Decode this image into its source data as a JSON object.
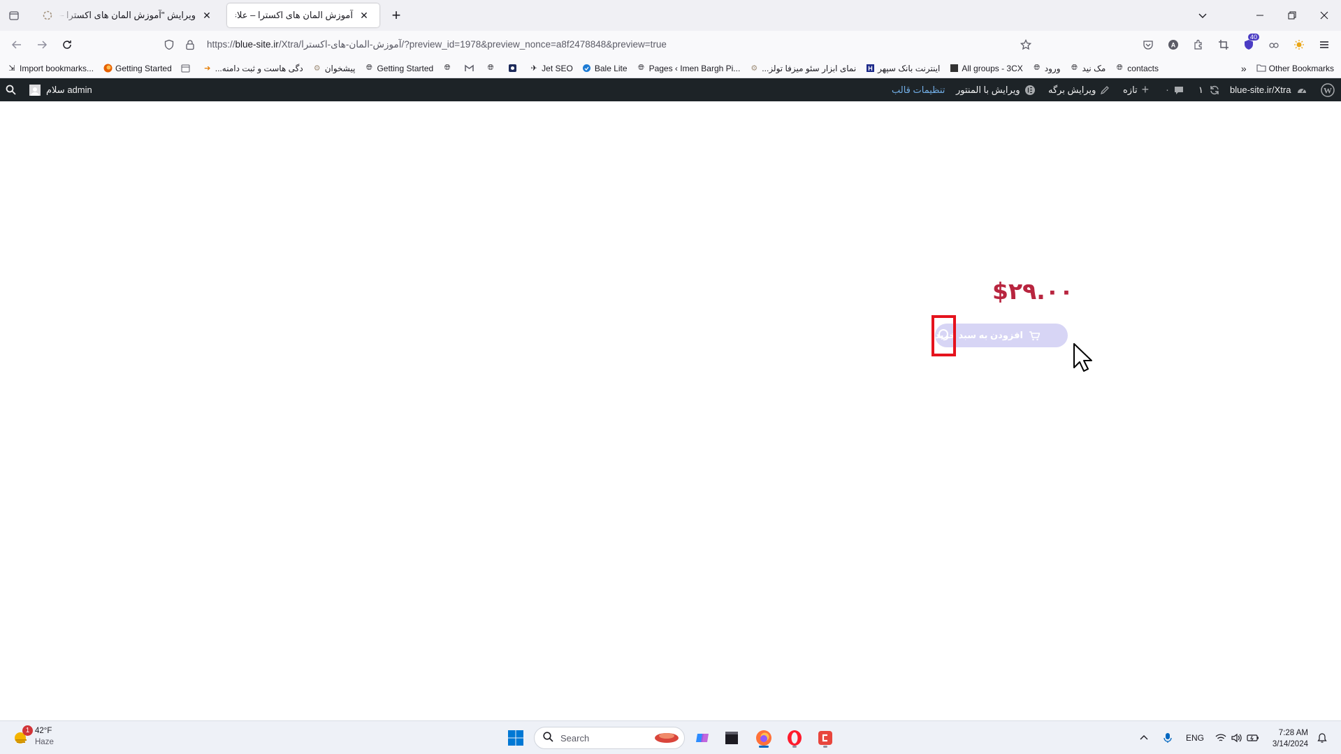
{
  "browser": {
    "tabs": [
      {
        "title": "ویرایش \"آموزش المان های اکسترا – علاءالدین",
        "active": false
      },
      {
        "title": "آموزش المان های اکسترا – علاءالدین",
        "active": true
      }
    ],
    "url": {
      "prefix": "https://",
      "host": "blue-site.ir",
      "path": "/Xtra/آموزش-المان-های-اکسترا/?preview_id=1978&preview_nonce=a8f2478848&preview=true"
    },
    "extension_badge": "40",
    "bookmarks": [
      {
        "label": "Import bookmarks...",
        "icon": "import-icon"
      },
      {
        "label": "Getting Started",
        "icon": "firefox-icon"
      },
      {
        "label": "",
        "icon": "calendar-icon"
      },
      {
        "label": "...دگی هاست و ثبت دامنه",
        "icon": "arrow-icon"
      },
      {
        "label": "پیشخوان",
        "icon": "gear-icon"
      },
      {
        "label": "Getting Started",
        "icon": "globe-icon"
      },
      {
        "label": "",
        "icon": "globe-icon"
      },
      {
        "label": "",
        "icon": "gmail-icon"
      },
      {
        "label": "",
        "icon": "globe-icon"
      },
      {
        "label": "",
        "icon": "app-icon"
      },
      {
        "label": "Jet SEO",
        "icon": "rocket-icon"
      },
      {
        "label": "Bale Lite",
        "icon": "bale-icon"
      },
      {
        "label": "Pages ‹ Imen Bargh Pi...",
        "icon": "globe-icon"
      },
      {
        "label": "...نمای ابزار سئو میزفا تولز",
        "icon": "gear-icon"
      },
      {
        "label": "اینترنت بانک سپهر",
        "icon": "bank-icon"
      },
      {
        "label": "All groups - 3CX",
        "icon": "3cx-icon"
      },
      {
        "label": "ورود",
        "icon": "globe-icon"
      },
      {
        "label": "مک نید",
        "icon": "globe-icon"
      },
      {
        "label": "contacts",
        "icon": "globe-icon"
      }
    ],
    "other_bookmarks": "Other Bookmarks"
  },
  "wp_admin_bar": {
    "greeting": "سلام admin",
    "site_name": "blue-site.ir/Xtra",
    "updates_count": "۱",
    "comments_count": "۰",
    "new_label": "تازه",
    "edit_page_label": "ویرایش برگه",
    "elementor_label": "ویرایش با المنتور",
    "theme_settings_label": "تنظیمات قالب"
  },
  "product": {
    "price": "$۲۹.۰۰",
    "add_to_cart_label": "افزودن به سبد خرید"
  },
  "taskbar": {
    "weather_temp": "42°F",
    "weather_desc": "Haze",
    "weather_badge": "1",
    "search_placeholder": "Search",
    "language": "ENG",
    "time": "7:28 AM",
    "date": "3/14/2024"
  },
  "colors": {
    "price": "#b8253f",
    "button_bg": "#d7d5f5",
    "highlight": "#e5131d",
    "wp_bar": "#1d2327",
    "wp_accent": "#72aee6"
  }
}
